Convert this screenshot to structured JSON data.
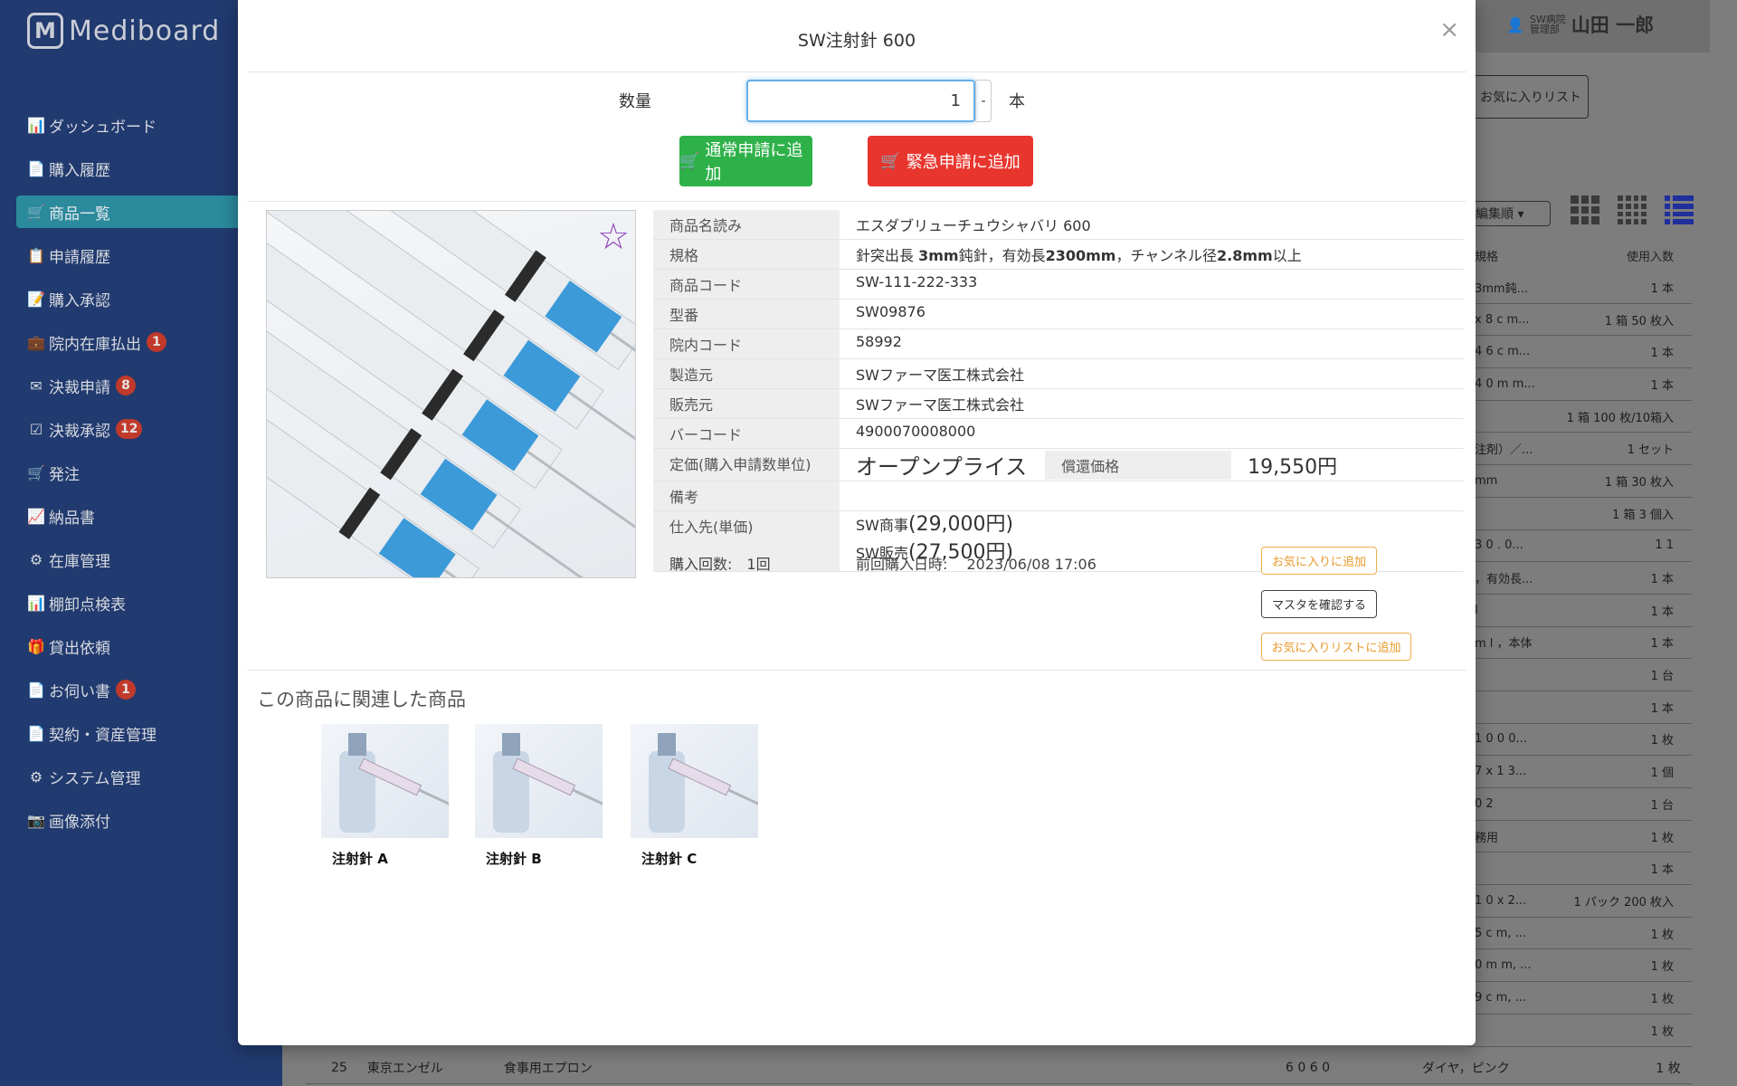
{
  "app": {
    "logo_mark": "M",
    "logo_text": "Mediboard"
  },
  "sidebar": {
    "items": [
      {
        "label": "ダッシュボード",
        "icon": "📊",
        "badge": ""
      },
      {
        "label": "購入履歴",
        "icon": "📄",
        "badge": ""
      },
      {
        "label": "商品一覧",
        "icon": "🛒",
        "badge": ""
      },
      {
        "label": "申請履歴",
        "icon": "📋",
        "badge": ""
      },
      {
        "label": "購入承認",
        "icon": "📝",
        "badge": ""
      },
      {
        "label": "院内在庫払出",
        "icon": "💼",
        "badge": "1"
      },
      {
        "label": "決裁申請",
        "icon": "✉",
        "badge": "8"
      },
      {
        "label": "決裁承認",
        "icon": "☑",
        "badge": "12"
      },
      {
        "label": "発注",
        "icon": "🛒",
        "badge": ""
      },
      {
        "label": "納品書",
        "icon": "📈",
        "badge": ""
      },
      {
        "label": "在庫管理",
        "icon": "⚙",
        "badge": ""
      },
      {
        "label": "棚卸点検表",
        "icon": "📊",
        "badge": ""
      },
      {
        "label": "貸出依頼",
        "icon": "🎁",
        "badge": ""
      },
      {
        "label": "お伺い書",
        "icon": "📄",
        "badge": "1"
      },
      {
        "label": "契約・資産管理",
        "icon": "📄",
        "badge": ""
      },
      {
        "label": "システム管理",
        "icon": "⚙",
        "badge": ""
      },
      {
        "label": "画像添付",
        "icon": "📷",
        "badge": ""
      }
    ],
    "active_index": 2
  },
  "header": {
    "org_line1": "SW病院",
    "org_line2": "管理部",
    "user_name": "山田 一郎"
  },
  "background": {
    "fav_list_button": "お気に入りリスト",
    "sort_label": "編集順 ▾",
    "col_spec": "規格",
    "col_qty": "使用入数",
    "rows": [
      {
        "spec": "3mm鈍...",
        "qty": "1 本"
      },
      {
        "spec": "x 8 c m...",
        "qty": "1 箱 50 枚入"
      },
      {
        "spec": "4 6 c m...",
        "qty": "1 本"
      },
      {
        "spec": "4 0 m m...",
        "qty": "1 本"
      },
      {
        "spec": "",
        "qty": "1 箱 100 枚/10箱入"
      },
      {
        "spec": "注剤）／...",
        "qty": "1 セット"
      },
      {
        "spec": "mm",
        "qty": "1 箱 30 枚入"
      },
      {
        "spec": "",
        "qty": "1 箱 3 個入"
      },
      {
        "spec": "3 0 . 0...",
        "qty": "1 1"
      },
      {
        "spec": "，有効長...",
        "qty": "1 本"
      },
      {
        "spec": "l",
        "qty": "1 本"
      },
      {
        "spec": "m l ，本体",
        "qty": "1 本"
      },
      {
        "spec": "",
        "qty": "1 台"
      },
      {
        "spec": "",
        "qty": "1 本"
      },
      {
        "spec": "1 0 0 0...",
        "qty": "1 枚"
      },
      {
        "spec": "7 x 1 3...",
        "qty": "1 個"
      },
      {
        "spec": "0 2",
        "qty": "1 台"
      },
      {
        "spec": "務用",
        "qty": "1 枚"
      },
      {
        "spec": "",
        "qty": "1 本"
      },
      {
        "spec": "1 0 x 2...",
        "qty": "1 パック 200 枚入"
      },
      {
        "spec": "5 c m, ...",
        "qty": "1 枚"
      },
      {
        "spec": "0 m m, ...",
        "qty": "1 枚"
      },
      {
        "spec": "9 c m, ...",
        "qty": "1 枚"
      },
      {
        "spec": "",
        "qty": "1 枚"
      }
    ],
    "bottom_row": {
      "no": "25",
      "maker": "東京エンゼル",
      "name": "食事用エプロン",
      "code": "6 0 6 0",
      "spec": "ダイヤ，ピンク",
      "qty": "1 枚"
    }
  },
  "modal": {
    "title": "SW注射針 600",
    "close": "×",
    "qty_label": "数量",
    "qty_value": "1",
    "qty_step": "-",
    "qty_unit": "本",
    "btn_normal": "通常申請に追加",
    "btn_urgent": "緊急申請に追加",
    "info": {
      "reading_label": "商品名読み",
      "reading": "エスダブリューチュウシャバリ 600",
      "spec_label": "規格",
      "spec_a": "針突出長 ",
      "spec_b": "3mm",
      "spec_c": "鈍針，有効長",
      "spec_d": "2300mm",
      "spec_e": "，チャンネル径",
      "spec_f": "2.8mm",
      "spec_g": "以上",
      "code_label": "商品コード",
      "code": "SW-111-222-333",
      "model_label": "型番",
      "model": "SW09876",
      "internal_label": "院内コード",
      "internal": "58992",
      "maker_label": "製造元",
      "maker": "SWファーマ医工株式会社",
      "seller_label": "販売元",
      "seller": "SWファーマ医工株式会社",
      "barcode_label": "バーコード",
      "barcode": "4900070008000",
      "price_label": "定価(購入申請数単位)",
      "price": "オープンプライス",
      "reimb_label": "償還価格",
      "reimb": "19,550円",
      "note_label": "備考",
      "note": "",
      "supplier_label": "仕入先(単価)",
      "sup1_name": "SW商事",
      "sup1_price": "(29,000円)",
      "sup2_name": "SW販売",
      "sup2_price": "(27,500円)"
    },
    "purchase_count": "購入回数:　1回",
    "last_purchase": "前回購入日時:　 2023/06/08 17:06",
    "btn_fav": "お気に入りに追加",
    "btn_master": "マスタを確認する",
    "btn_favlist": "お気に入りリストに追加",
    "related_title": "この商品に関連した商品",
    "related": [
      {
        "name": "注射針 A"
      },
      {
        "name": "注射針 B"
      },
      {
        "name": "注射針 C"
      }
    ]
  }
}
